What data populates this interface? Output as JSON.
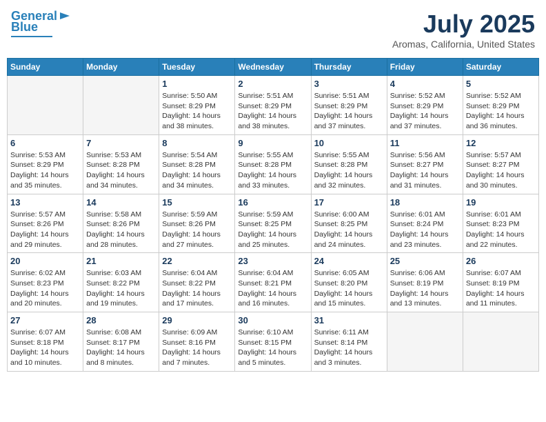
{
  "header": {
    "logo_line1": "General",
    "logo_line2": "Blue",
    "month_title": "July 2025",
    "location": "Aromas, California, United States"
  },
  "weekdays": [
    "Sunday",
    "Monday",
    "Tuesday",
    "Wednesday",
    "Thursday",
    "Friday",
    "Saturday"
  ],
  "weeks": [
    [
      {
        "day": "",
        "info": ""
      },
      {
        "day": "",
        "info": ""
      },
      {
        "day": "1",
        "info": "Sunrise: 5:50 AM\nSunset: 8:29 PM\nDaylight: 14 hours\nand 38 minutes."
      },
      {
        "day": "2",
        "info": "Sunrise: 5:51 AM\nSunset: 8:29 PM\nDaylight: 14 hours\nand 38 minutes."
      },
      {
        "day": "3",
        "info": "Sunrise: 5:51 AM\nSunset: 8:29 PM\nDaylight: 14 hours\nand 37 minutes."
      },
      {
        "day": "4",
        "info": "Sunrise: 5:52 AM\nSunset: 8:29 PM\nDaylight: 14 hours\nand 37 minutes."
      },
      {
        "day": "5",
        "info": "Sunrise: 5:52 AM\nSunset: 8:29 PM\nDaylight: 14 hours\nand 36 minutes."
      }
    ],
    [
      {
        "day": "6",
        "info": "Sunrise: 5:53 AM\nSunset: 8:29 PM\nDaylight: 14 hours\nand 35 minutes."
      },
      {
        "day": "7",
        "info": "Sunrise: 5:53 AM\nSunset: 8:28 PM\nDaylight: 14 hours\nand 34 minutes."
      },
      {
        "day": "8",
        "info": "Sunrise: 5:54 AM\nSunset: 8:28 PM\nDaylight: 14 hours\nand 34 minutes."
      },
      {
        "day": "9",
        "info": "Sunrise: 5:55 AM\nSunset: 8:28 PM\nDaylight: 14 hours\nand 33 minutes."
      },
      {
        "day": "10",
        "info": "Sunrise: 5:55 AM\nSunset: 8:28 PM\nDaylight: 14 hours\nand 32 minutes."
      },
      {
        "day": "11",
        "info": "Sunrise: 5:56 AM\nSunset: 8:27 PM\nDaylight: 14 hours\nand 31 minutes."
      },
      {
        "day": "12",
        "info": "Sunrise: 5:57 AM\nSunset: 8:27 PM\nDaylight: 14 hours\nand 30 minutes."
      }
    ],
    [
      {
        "day": "13",
        "info": "Sunrise: 5:57 AM\nSunset: 8:26 PM\nDaylight: 14 hours\nand 29 minutes."
      },
      {
        "day": "14",
        "info": "Sunrise: 5:58 AM\nSunset: 8:26 PM\nDaylight: 14 hours\nand 28 minutes."
      },
      {
        "day": "15",
        "info": "Sunrise: 5:59 AM\nSunset: 8:26 PM\nDaylight: 14 hours\nand 27 minutes."
      },
      {
        "day": "16",
        "info": "Sunrise: 5:59 AM\nSunset: 8:25 PM\nDaylight: 14 hours\nand 25 minutes."
      },
      {
        "day": "17",
        "info": "Sunrise: 6:00 AM\nSunset: 8:25 PM\nDaylight: 14 hours\nand 24 minutes."
      },
      {
        "day": "18",
        "info": "Sunrise: 6:01 AM\nSunset: 8:24 PM\nDaylight: 14 hours\nand 23 minutes."
      },
      {
        "day": "19",
        "info": "Sunrise: 6:01 AM\nSunset: 8:23 PM\nDaylight: 14 hours\nand 22 minutes."
      }
    ],
    [
      {
        "day": "20",
        "info": "Sunrise: 6:02 AM\nSunset: 8:23 PM\nDaylight: 14 hours\nand 20 minutes."
      },
      {
        "day": "21",
        "info": "Sunrise: 6:03 AM\nSunset: 8:22 PM\nDaylight: 14 hours\nand 19 minutes."
      },
      {
        "day": "22",
        "info": "Sunrise: 6:04 AM\nSunset: 8:22 PM\nDaylight: 14 hours\nand 17 minutes."
      },
      {
        "day": "23",
        "info": "Sunrise: 6:04 AM\nSunset: 8:21 PM\nDaylight: 14 hours\nand 16 minutes."
      },
      {
        "day": "24",
        "info": "Sunrise: 6:05 AM\nSunset: 8:20 PM\nDaylight: 14 hours\nand 15 minutes."
      },
      {
        "day": "25",
        "info": "Sunrise: 6:06 AM\nSunset: 8:19 PM\nDaylight: 14 hours\nand 13 minutes."
      },
      {
        "day": "26",
        "info": "Sunrise: 6:07 AM\nSunset: 8:19 PM\nDaylight: 14 hours\nand 11 minutes."
      }
    ],
    [
      {
        "day": "27",
        "info": "Sunrise: 6:07 AM\nSunset: 8:18 PM\nDaylight: 14 hours\nand 10 minutes."
      },
      {
        "day": "28",
        "info": "Sunrise: 6:08 AM\nSunset: 8:17 PM\nDaylight: 14 hours\nand 8 minutes."
      },
      {
        "day": "29",
        "info": "Sunrise: 6:09 AM\nSunset: 8:16 PM\nDaylight: 14 hours\nand 7 minutes."
      },
      {
        "day": "30",
        "info": "Sunrise: 6:10 AM\nSunset: 8:15 PM\nDaylight: 14 hours\nand 5 minutes."
      },
      {
        "day": "31",
        "info": "Sunrise: 6:11 AM\nSunset: 8:14 PM\nDaylight: 14 hours\nand 3 minutes."
      },
      {
        "day": "",
        "info": ""
      },
      {
        "day": "",
        "info": ""
      }
    ]
  ]
}
